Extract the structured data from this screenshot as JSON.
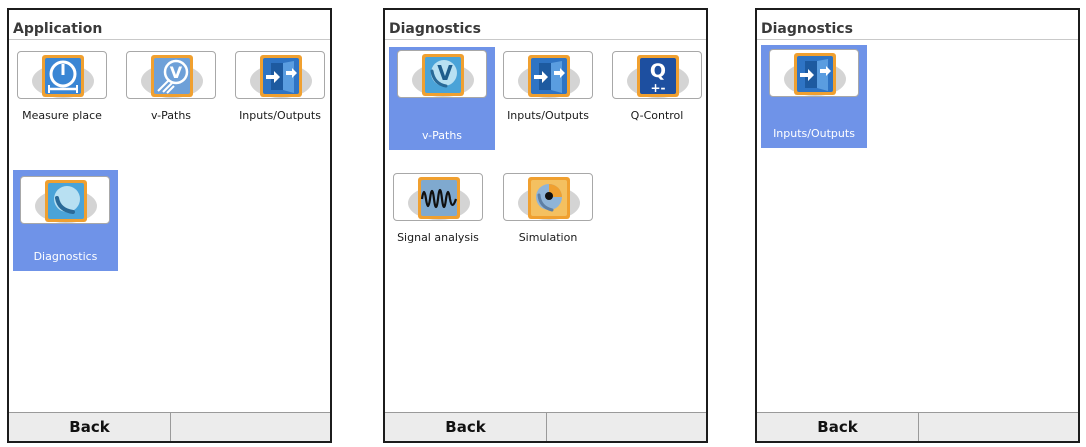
{
  "screens": [
    {
      "title": "Application",
      "tiles": [
        {
          "label": "Measure place",
          "icon": "measure-place-icon"
        },
        {
          "label": "v-Paths",
          "icon": "v-paths-icon"
        },
        {
          "label": "Inputs/Outputs",
          "icon": "inputs-outputs-icon"
        },
        {
          "label": "Diagnostics",
          "icon": "diagnostics-icon",
          "selected": true
        }
      ],
      "footer": {
        "left": "Back",
        "right": ""
      }
    },
    {
      "title": "Diagnostics",
      "tiles": [
        {
          "label": "v-Paths",
          "icon": "v-paths-icon",
          "selected": true
        },
        {
          "label": "Inputs/Outputs",
          "icon": "inputs-outputs-icon"
        },
        {
          "label": "Q-Control",
          "icon": "q-control-icon"
        },
        {
          "label": "Signal analysis",
          "icon": "signal-analysis-icon"
        },
        {
          "label": "Simulation",
          "icon": "simulation-icon"
        }
      ],
      "footer": {
        "left": "Back",
        "right": ""
      }
    },
    {
      "title": "Diagnostics",
      "tiles": [
        {
          "label": "Inputs/Outputs",
          "icon": "inputs-outputs-icon",
          "selected": true
        }
      ],
      "footer": {
        "left": "Back",
        "right": ""
      }
    }
  ],
  "colors": {
    "selection": "#6f93e8",
    "icon_orange": "#f0a030",
    "icon_blue": "#2f74c4"
  }
}
